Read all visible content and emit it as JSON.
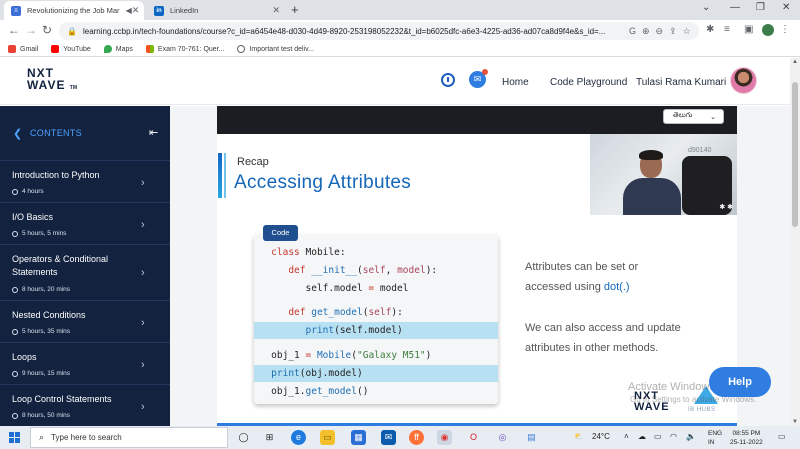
{
  "browser": {
    "tabs": [
      {
        "title": "Revolutionizing the Job Mar",
        "active": true
      },
      {
        "title": "LinkedIn",
        "active": false
      }
    ],
    "url": "learning.ccbp.in/tech-foundations/course?c_id=a6454e48-d030-4d49-8920-253198052232&t_id=b6025dfc-a6e3-4225-ad36-ad07ca8d9f4e&s_id=...",
    "bookmarks": [
      "Gmail",
      "YouTube",
      "Maps",
      "Exam 70-761: Quer...",
      "Important test deliv..."
    ]
  },
  "header": {
    "logo_top": "NXT",
    "logo_bottom": "WAVE",
    "logo_tm": "TM",
    "home": "Home",
    "code_playground": "Code Playground",
    "username": "Tulasi Rama Kumari"
  },
  "sidebar": {
    "title": "CONTENTS",
    "items": [
      {
        "name": "Introduction to Python",
        "duration": "4 hours"
      },
      {
        "name": "I/O Basics",
        "duration": "5 hours, 5 mins"
      },
      {
        "name": "Operators & Conditional Statements",
        "duration": "8 hours, 20 mins"
      },
      {
        "name": "Nested Conditions",
        "duration": "5 hours, 35 mins"
      },
      {
        "name": "Loops",
        "duration": "9 hours, 15 mins"
      },
      {
        "name": "Loop Control Statements",
        "duration": "8 hours, 50 mins"
      }
    ]
  },
  "video": {
    "language": "తెలుగు",
    "recap": "Recap",
    "title": "Accessing Attributes",
    "code_tag": "Code",
    "watermark": "d90140",
    "para1_line1": "Attributes can be set or",
    "para1_line2": "accessed using ",
    "para1_code": "dot(.)",
    "para2_line1": "We can also access and update",
    "para2_line2": "attributes in other methods.",
    "footer_logo_top": "NXT",
    "footer_logo_bottom": "WAVE",
    "partner": "IB HUBS"
  },
  "overlay": {
    "activate_title": "Activate Windows",
    "activate_sub": "Go to Settings to activate Windows.",
    "help": "Help"
  },
  "taskbar": {
    "search_placeholder": "Type here to search",
    "weather": "24°C",
    "lang_line1": "ENG",
    "lang_line2": "IN",
    "time": "08:55 PM",
    "date": "25-11-2022"
  },
  "colors": {
    "sidebar_bg": "#12223f",
    "accent": "#2f7de1",
    "title_blue": "#1366b8",
    "code_highlight": "#b7e0f3"
  }
}
